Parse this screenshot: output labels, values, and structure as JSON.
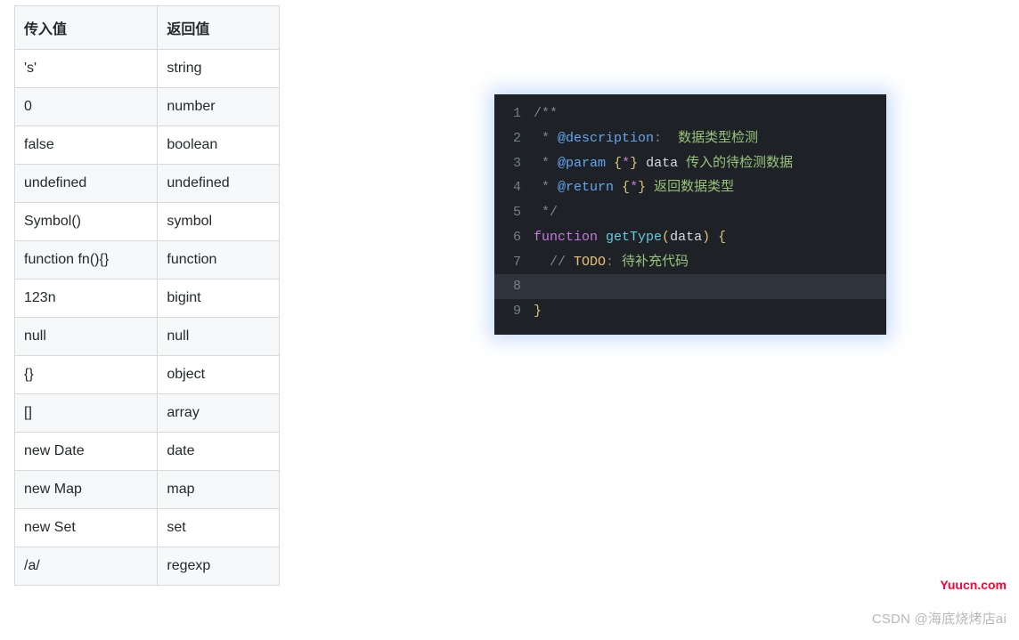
{
  "table": {
    "headers": [
      "传入值",
      "返回值"
    ],
    "rows": [
      {
        "in": "'s'",
        "out": "string"
      },
      {
        "in": "0",
        "out": "number"
      },
      {
        "in": "false",
        "out": "boolean"
      },
      {
        "in": "undefined",
        "out": "undefined"
      },
      {
        "in": "Symbol()",
        "out": "symbol"
      },
      {
        "in": "function fn(){}",
        "out": "function"
      },
      {
        "in": "123n",
        "out": "bigint"
      },
      {
        "in": "null",
        "out": "null"
      },
      {
        "in": "{}",
        "out": "object"
      },
      {
        "in": "[]",
        "out": "array"
      },
      {
        "in": "new Date",
        "out": "date"
      },
      {
        "in": "new Map",
        "out": "map"
      },
      {
        "in": "new Set",
        "out": "set"
      },
      {
        "in": "/a/",
        "out": "regexp"
      }
    ]
  },
  "code": {
    "line_numbers": [
      "1",
      "2",
      "3",
      "4",
      "5",
      "6",
      "7",
      "8",
      "9"
    ],
    "l1": "/**",
    "l2_a": " * ",
    "l2_b": "@description",
    "l2_c": ": ",
    "l2_d": " 数据类型检测",
    "l3_a": " * ",
    "l3_b": "@param",
    "l3_c": " ",
    "l3_d": "{",
    "l3_e": "*",
    "l3_f": "}",
    "l3_g": " ",
    "l3_h": "data",
    "l3_i": " 传入的待检测数据",
    "l4_a": " * ",
    "l4_b": "@return",
    "l4_c": " ",
    "l4_d": "{",
    "l4_e": "*",
    "l4_f": "}",
    "l4_g": " 返回数据类型",
    "l5": " */",
    "l6_a": "function",
    "l6_b": " ",
    "l6_c": "getType",
    "l6_d": "(",
    "l6_e": "data",
    "l6_f": ")",
    "l6_g": " ",
    "l6_h": "{",
    "l7_a": "  // ",
    "l7_b": "TODO",
    "l7_c": ": ",
    "l7_d": "待补充代码",
    "l8": "",
    "l9": "}"
  },
  "brand": "Yuucn.com",
  "watermark": "CSDN @海底烧烤店ai"
}
